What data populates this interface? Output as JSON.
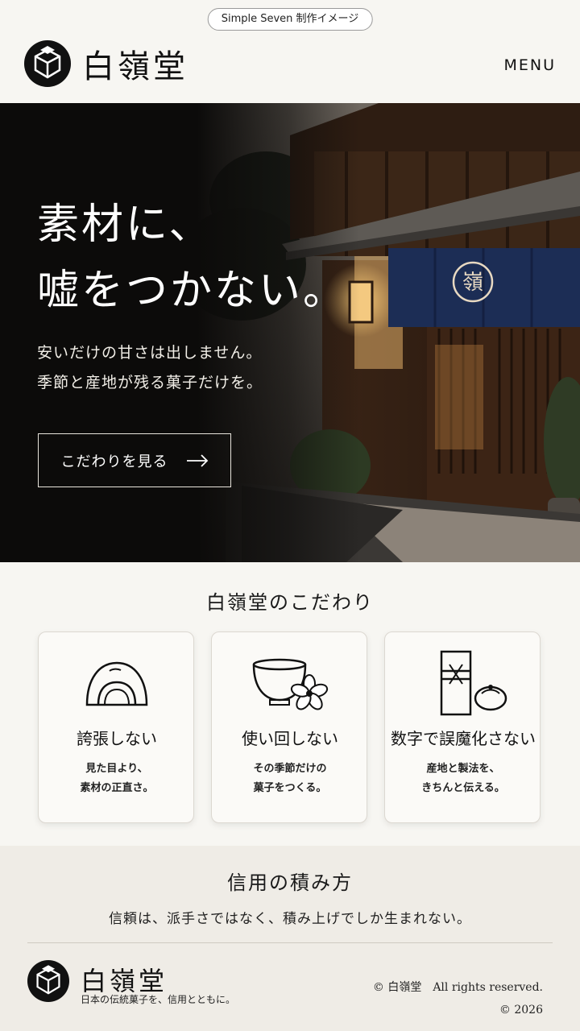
{
  "badge": "Simple Seven 制作イメージ",
  "header": {
    "brand": "白嶺堂",
    "menu": "MENU"
  },
  "hero": {
    "title_line1": "素材に、",
    "title_line2": "嘘をつかない。",
    "sub_line1": "安いだけの甘さは出しません。",
    "sub_line2": "季節と産地が残る菓子だけを。",
    "cta": "こだわりを見る",
    "noren_mark": "嶺"
  },
  "commitments": {
    "title": "白嶺堂のこだわり",
    "cards": [
      {
        "icon": "daifuku-icon",
        "title": "誇張しない",
        "line1": "見た目より、",
        "line2": "素材の正直さ。"
      },
      {
        "icon": "bowl-flower-icon",
        "title": "使い回しない",
        "line1": "その季節だけの",
        "line2": "菓子をつくる。"
      },
      {
        "icon": "gift-box-icon",
        "title": "数字で誤魔化さない",
        "line1": "産地と製法を、",
        "line2": "きちんと伝える。"
      }
    ]
  },
  "trust": {
    "title": "信用の積み方",
    "text": "信頼は、派手さではなく、積み上げでしか生まれない。"
  },
  "footer": {
    "brand": "白嶺堂",
    "tagline": "日本の伝統菓子を、信用とともに。",
    "copyright_line1": "© 白嶺堂　All rights reserved.",
    "copyright_line2": "© 2026"
  },
  "colors": {
    "background": "#f7f6f2",
    "hero_dark": "#0e0d0c",
    "noren_navy": "#1c2d55",
    "trust_band": "#efece6"
  }
}
